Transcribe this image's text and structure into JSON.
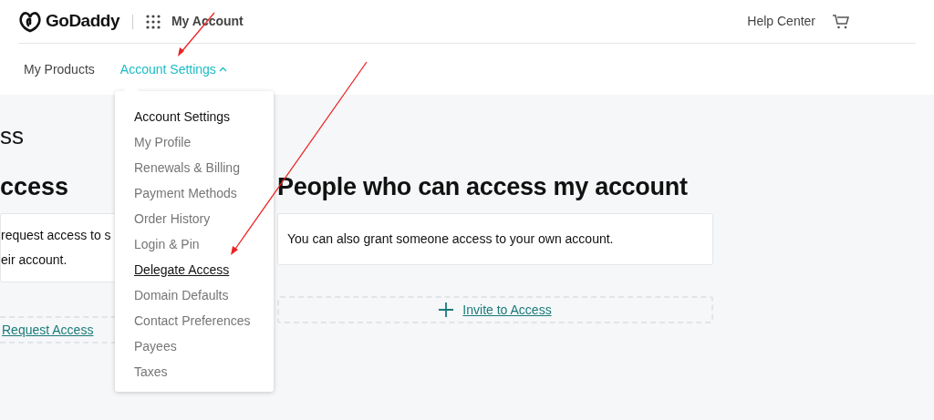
{
  "header": {
    "brand": "GoDaddy",
    "app_title": "My Account",
    "help_link": "Help Center"
  },
  "nav": [
    {
      "label": "My Products",
      "selected": false,
      "expanded": false
    },
    {
      "label": "Account Settings",
      "selected": true,
      "expanded": true
    }
  ],
  "menu": {
    "items": [
      {
        "label": "Account Settings",
        "kind": "heading"
      },
      {
        "label": "My Profile",
        "kind": "link",
        "selected": false
      },
      {
        "label": "Renewals & Billing",
        "kind": "link",
        "selected": false
      },
      {
        "label": "Payment Methods",
        "kind": "link",
        "selected": false
      },
      {
        "label": "Order History",
        "kind": "link",
        "selected": false
      },
      {
        "label": "Login & Pin",
        "kind": "link",
        "selected": false
      },
      {
        "label": "Delegate Access",
        "kind": "link",
        "selected": true
      },
      {
        "label": "Domain Defaults",
        "kind": "link",
        "selected": false
      },
      {
        "label": "Contact Preferences",
        "kind": "link",
        "selected": false
      },
      {
        "label": "Payees",
        "kind": "link",
        "selected": false
      },
      {
        "label": "Taxes",
        "kind": "link",
        "selected": false
      }
    ]
  },
  "page_title": "ss",
  "left_section": {
    "heading": "ccess",
    "card_lines": [
      "request access to s",
      "eir account."
    ],
    "action": "Request Access"
  },
  "right_section": {
    "heading": "People who can access my account",
    "card_text": "You can also grant someone access to your own account.",
    "action": "Invite to Access"
  }
}
